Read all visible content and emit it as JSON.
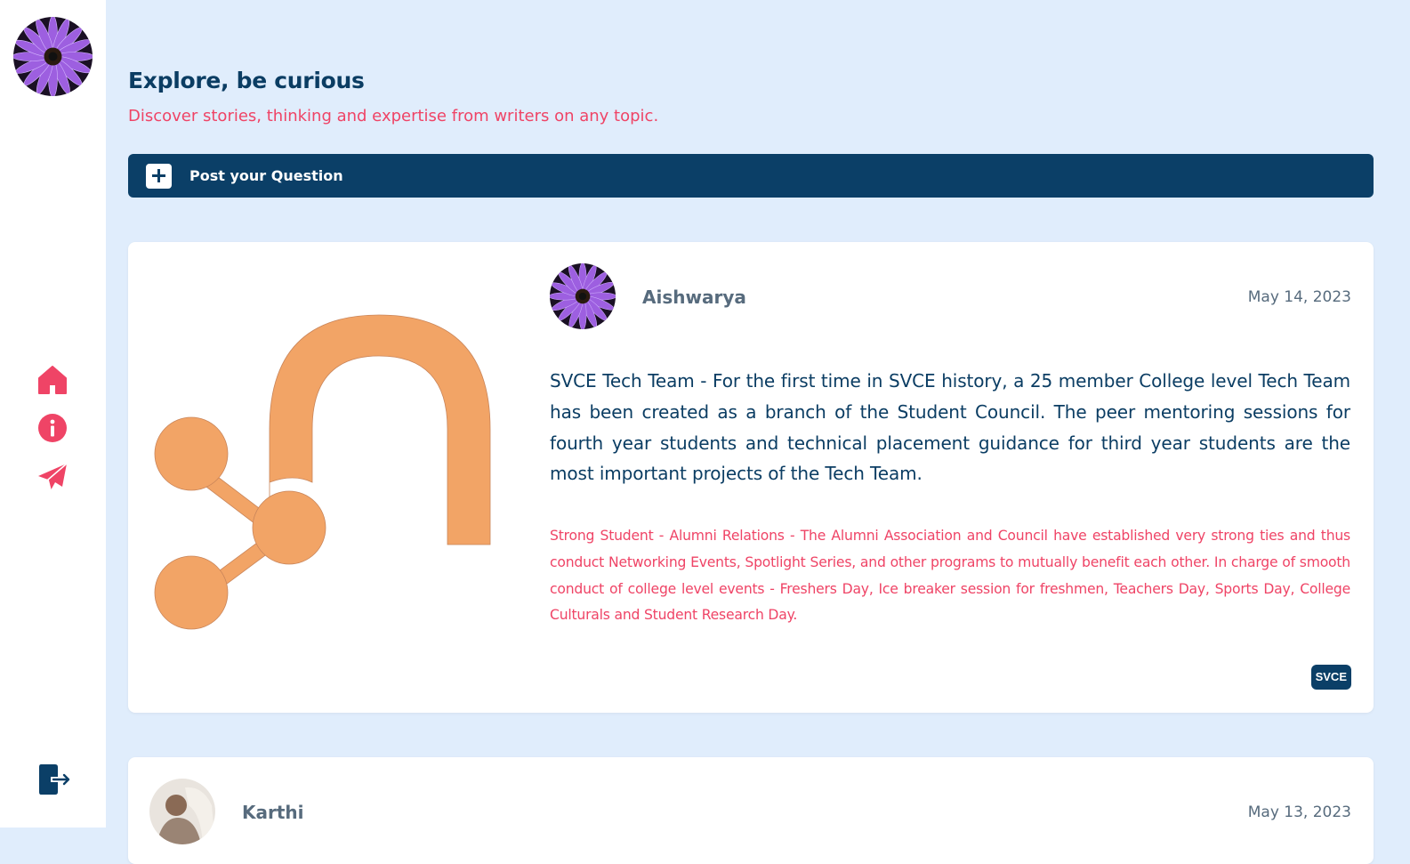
{
  "header": {
    "title": "Explore, be curious",
    "subtitle": "Discover stories, thinking and expertise from writers on any topic."
  },
  "post_button": {
    "label": "Post your Question",
    "icon": "plus-icon"
  },
  "sidebar": {
    "items": [
      {
        "name": "home",
        "icon": "home-icon"
      },
      {
        "name": "info",
        "icon": "info-icon"
      },
      {
        "name": "send",
        "icon": "send-icon"
      }
    ],
    "logout_icon": "logout-icon"
  },
  "posts": [
    {
      "author": "Aishwarya",
      "date": "May 14, 2023",
      "question": "SVCE Tech Team - For the first time in SVCE history, a 25 member College level Tech Team has been created as a branch of the Student Council. The peer mentoring sessions for fourth year students and technical placement guidance for third year students are the most important projects of the Tech Team.",
      "answer": "Strong Student - Alumni Relations - The Alumni Association and Council have established very strong ties and thus conduct Networking Events, Spotlight Series, and other programs to mutually benefit each other. In charge of smooth conduct of college level events - Freshers Day, Ice breaker session for freshmen, Teachers Day, Sports Day, College Culturals and Student Research Day.",
      "tag": "SVCE"
    },
    {
      "author": "Karthi",
      "date": "May 13, 2023"
    }
  ],
  "colors": {
    "accent": "#ef4466",
    "navy": "#0b3f67",
    "background": "#e0edfc",
    "image_orange": "#f2a466"
  }
}
